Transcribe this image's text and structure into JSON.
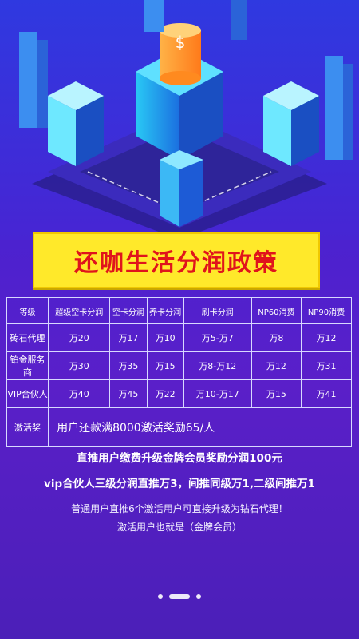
{
  "title": "还咖生活分润政策",
  "table": {
    "headers": [
      "等级",
      "超级空卡分润",
      "空卡分润",
      "养卡分润",
      "刷卡分润",
      "NP60消费",
      "NP90消费"
    ],
    "rows": [
      [
        "砖石代理",
        "万20",
        "万17",
        "万10",
        "万5-万7",
        "万8",
        "万12"
      ],
      [
        "铂金服务商",
        "万30",
        "万35",
        "万15",
        "万8-万12",
        "万12",
        "万31"
      ],
      [
        "VIP合伙人",
        "万40",
        "万45",
        "万22",
        "万10-万17",
        "万15",
        "万41"
      ]
    ],
    "bonus_label": "激活奖",
    "bonus_text": "用户还款满8000激活奖励65/人"
  },
  "notes": {
    "line1": "直推用户缴费升级金牌会员奖励分润100元",
    "line2": "vip合伙人三级分润直推万3，间推同级万1,二级间推万1",
    "line3": "普通用户直推6个激活用户可直接升级为钻石代理！",
    "line4": "激活用户也就是（金牌会员）"
  },
  "colors": {
    "banner_bg": "#ffe92a",
    "banner_text": "#e0141c",
    "accent": "#4a22d0"
  }
}
